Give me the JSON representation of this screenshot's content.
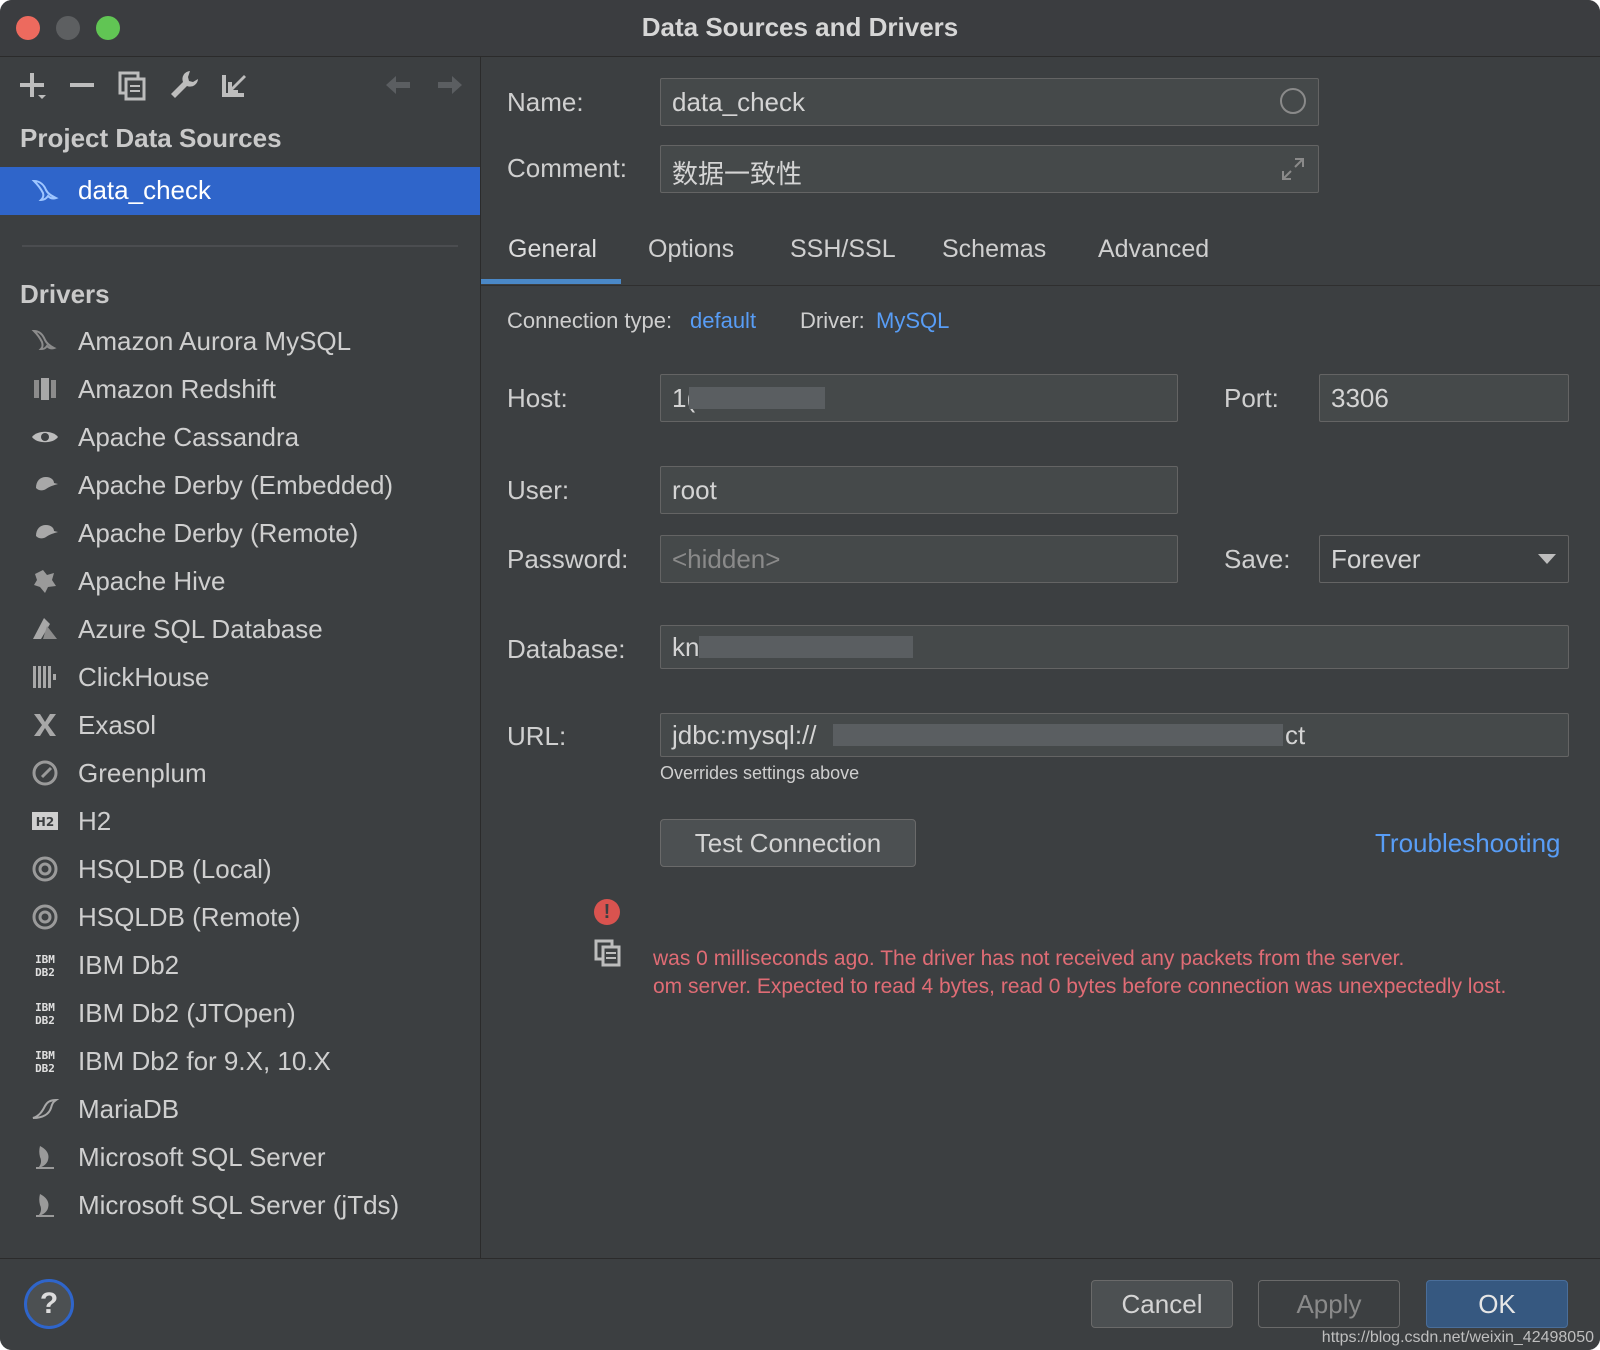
{
  "window": {
    "title": "Data Sources and Drivers"
  },
  "sidebar": {
    "project_title": "Project Data Sources",
    "data_source": "data_check",
    "drivers_title": "Drivers",
    "drivers": [
      {
        "label": "Amazon Aurora MySQL",
        "icon": "dolphin-icon"
      },
      {
        "label": "Amazon Redshift",
        "icon": "redshift-icon"
      },
      {
        "label": "Apache Cassandra",
        "icon": "eye-icon"
      },
      {
        "label": "Apache Derby (Embedded)",
        "icon": "derby-hat-icon"
      },
      {
        "label": "Apache Derby (Remote)",
        "icon": "derby-hat-icon"
      },
      {
        "label": "Apache Hive",
        "icon": "hive-icon"
      },
      {
        "label": "Azure SQL Database",
        "icon": "azure-icon"
      },
      {
        "label": "ClickHouse",
        "icon": "clickhouse-icon"
      },
      {
        "label": "Exasol",
        "icon": "exasol-icon"
      },
      {
        "label": "Greenplum",
        "icon": "greenplum-icon"
      },
      {
        "label": "H2",
        "icon": "h2-icon"
      },
      {
        "label": "HSQLDB (Local)",
        "icon": "hsqldb-icon"
      },
      {
        "label": "HSQLDB (Remote)",
        "icon": "hsqldb-icon"
      },
      {
        "label": "IBM Db2",
        "icon": "ibm-db2-icon"
      },
      {
        "label": "IBM Db2 (JTOpen)",
        "icon": "ibm-db2-icon"
      },
      {
        "label": "IBM Db2 for 9.X, 10.X",
        "icon": "ibm-db2-icon"
      },
      {
        "label": "MariaDB",
        "icon": "mariadb-icon"
      },
      {
        "label": "Microsoft SQL Server",
        "icon": "sqlserver-icon"
      },
      {
        "label": "Microsoft SQL Server (jTds)",
        "icon": "sqlserver-icon"
      }
    ]
  },
  "form": {
    "name_label": "Name:",
    "name_value": "data_check",
    "comment_label": "Comment:",
    "comment_value": "数据一致性",
    "tabs": [
      "General",
      "Options",
      "SSH/SSL",
      "Schemas",
      "Advanced"
    ],
    "connection_type_label": "Connection type:",
    "connection_type_value": "default",
    "driver_label": "Driver:",
    "driver_value": "MySQL",
    "host_label": "Host:",
    "host_value": "1(",
    "port_label": "Port:",
    "port_value": "3306",
    "user_label": "User:",
    "user_value": "root",
    "password_label": "Password:",
    "password_placeholder": "<hidden>",
    "save_label": "Save:",
    "save_value": "Forever",
    "database_label": "Database:",
    "database_value": "kn",
    "url_label": "URL:",
    "url_value": "jdbc:mysql://",
    "url_tail": "ct",
    "url_hint": "Overrides settings above",
    "test_button": "Test Connection",
    "troubleshooting": "Troubleshooting",
    "error_line1": "was 0 milliseconds ago. The driver has not received any packets from the server.",
    "error_line2": "om server. Expected to read 4 bytes, read 0 bytes before connection was unexpectedly lost."
  },
  "footer": {
    "help": "?",
    "cancel": "Cancel",
    "apply": "Apply",
    "ok": "OK",
    "watermark": "https://blog.csdn.net/weixin_42498050"
  },
  "colors": {
    "selection": "#2f65ca",
    "link": "#589df6",
    "error": "#e06c75",
    "ok_button": "#365880"
  }
}
